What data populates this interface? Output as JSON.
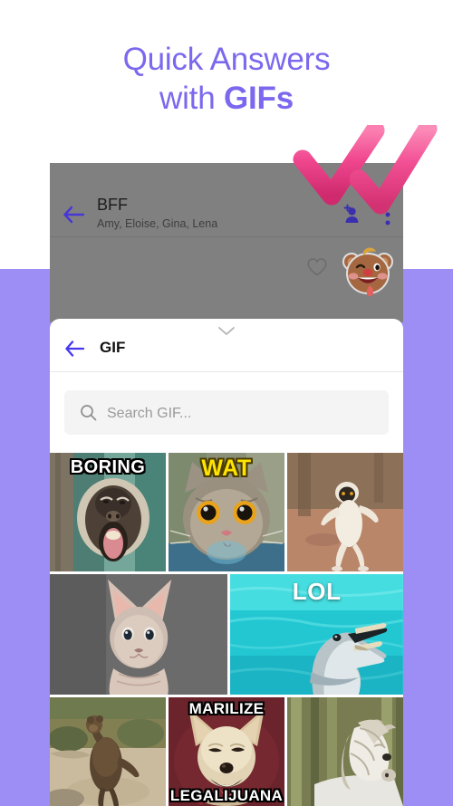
{
  "promo": {
    "line1": "Quick Answers",
    "line2_prefix": "with ",
    "line2_bold": "GIFs",
    "accent_color": "#7b68ee",
    "background_top": "#ffffff",
    "background_band": "#9d8ef6"
  },
  "chat": {
    "back_icon": "arrow-left-icon",
    "title": "BFF",
    "subtitle": "Amy, Eloise, Gina, Lena",
    "add_person_icon": "add-person-icon",
    "overflow_icon": "overflow-menu-icon",
    "heart_icon": "heart-outline-icon",
    "sticker": "bear-winking-tongue-sticker",
    "overlay_icon": "double-check-mark",
    "overlay_color": "#f0478f"
  },
  "gif_sheet": {
    "handle_icon": "chevron-down-icon",
    "back_icon": "arrow-left-icon",
    "title": "GIF",
    "search": {
      "icon": "search-icon",
      "placeholder": "Search GIF...",
      "value": ""
    },
    "grid": {
      "rows": [
        {
          "tiles": [
            {
              "name": "gif-tile-boring-monkey",
              "label": "BORING",
              "label_style": "white-outline",
              "flex": 1
            },
            {
              "name": "gif-tile-wat-cat",
              "label": "WAT",
              "label_style": "yellow-outline",
              "flex": 1
            },
            {
              "name": "gif-tile-dancing-lemur",
              "label": "",
              "label_style": "none",
              "flex": 1
            }
          ]
        },
        {
          "tiles": [
            {
              "name": "gif-tile-sphynx-cat",
              "label": "",
              "label_style": "none",
              "flex": 1.03
            },
            {
              "name": "gif-tile-lol-dolphin",
              "label": "LOL",
              "label_style": "plain-white",
              "flex": 1
            }
          ]
        },
        {
          "tiles": [
            {
              "name": "gif-tile-dancing-bear",
              "label": "",
              "label_style": "none",
              "flex": 1
            },
            {
              "name": "gif-tile-marilize-chihuahua",
              "label": "MARILIZE",
              "label2": "LEGALIJUANA",
              "label_style": "white-outline",
              "flex": 1
            },
            {
              "name": "gif-tile-white-pony",
              "label": "",
              "label_style": "none",
              "flex": 1
            }
          ]
        }
      ]
    }
  }
}
